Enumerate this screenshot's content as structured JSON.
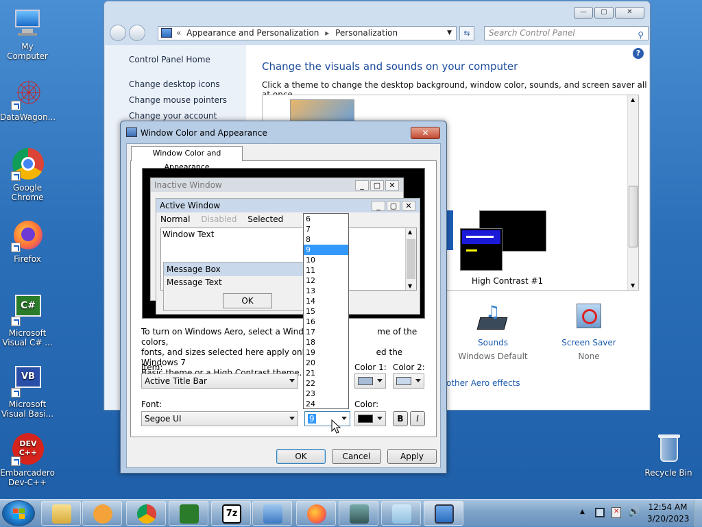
{
  "desktop": {
    "icons": [
      {
        "label": "My Computer",
        "icon": "computer-icon"
      },
      {
        "label": "DataWagon...",
        "icon": "datawagon-icon"
      },
      {
        "label": "Google Chrome",
        "icon": "chrome-icon"
      },
      {
        "label": "Firefox",
        "icon": "firefox-icon"
      },
      {
        "label": "Microsoft Visual C# ...",
        "icon": "csharp-icon"
      },
      {
        "label": "Microsoft Visual Basi...",
        "icon": "vb-icon"
      },
      {
        "label": "Embarcadero Dev-C++",
        "icon": "devcpp-icon"
      },
      {
        "label": "Recycle Bin",
        "icon": "recycle-bin-icon"
      }
    ]
  },
  "control_panel": {
    "breadcrumb": [
      "Appearance and Personalization",
      "Personalization"
    ],
    "search_placeholder": "Search Control Panel",
    "left_links": [
      "Control Panel Home",
      "Change desktop icons",
      "Change mouse pointers",
      "Change your account picture"
    ],
    "heading": "Change the visuals and sounds on your computer",
    "subheading": "Click a theme to change the desktop background, window color, sounds, and screen saver all at once.",
    "theme_label": "High Contrast #1",
    "sounds": {
      "label": "Sounds",
      "value": "Windows Default"
    },
    "screensaver": {
      "label": "Screen Saver",
      "value": "None"
    },
    "aero_link": "other Aero effects"
  },
  "dialog": {
    "title": "Window Color and Appearance",
    "tab": "Window Color and Appearance",
    "preview": {
      "inactive_title": "Inactive Window",
      "active_title": "Active Window",
      "menu": {
        "normal": "Normal",
        "disabled": "Disabled",
        "selected": "Selected"
      },
      "window_text": "Window Text",
      "message_box": "Message Box",
      "message_text": "Message Text",
      "ok": "OK"
    },
    "info_line1": "To turn on Windows Aero, select a Windows",
    "info_line1b": "me of the colors,",
    "info_line2": "fonts, and sizes selected here apply only if yo",
    "info_line2b": "ed the Windows 7",
    "info_line3": "Basic theme or a High Contrast theme.",
    "item_label": "Item:",
    "item_value": "Active Title Bar",
    "color1_label": "Color 1:",
    "color2_label": "Color 2:",
    "font_label": "Font:",
    "font_value": "Segoe UI",
    "size_value": "9",
    "color_label": "Color:",
    "bold": "B",
    "italic": "I",
    "ok": "OK",
    "cancel": "Cancel",
    "apply": "Apply",
    "size_options": [
      "6",
      "7",
      "8",
      "9",
      "10",
      "11",
      "12",
      "13",
      "14",
      "15",
      "16",
      "17",
      "18",
      "19",
      "20",
      "21",
      "22",
      "23",
      "24"
    ],
    "size_selected": "9"
  },
  "taskbar": {
    "time": "12:54 AM",
    "date": "3/20/2023"
  }
}
